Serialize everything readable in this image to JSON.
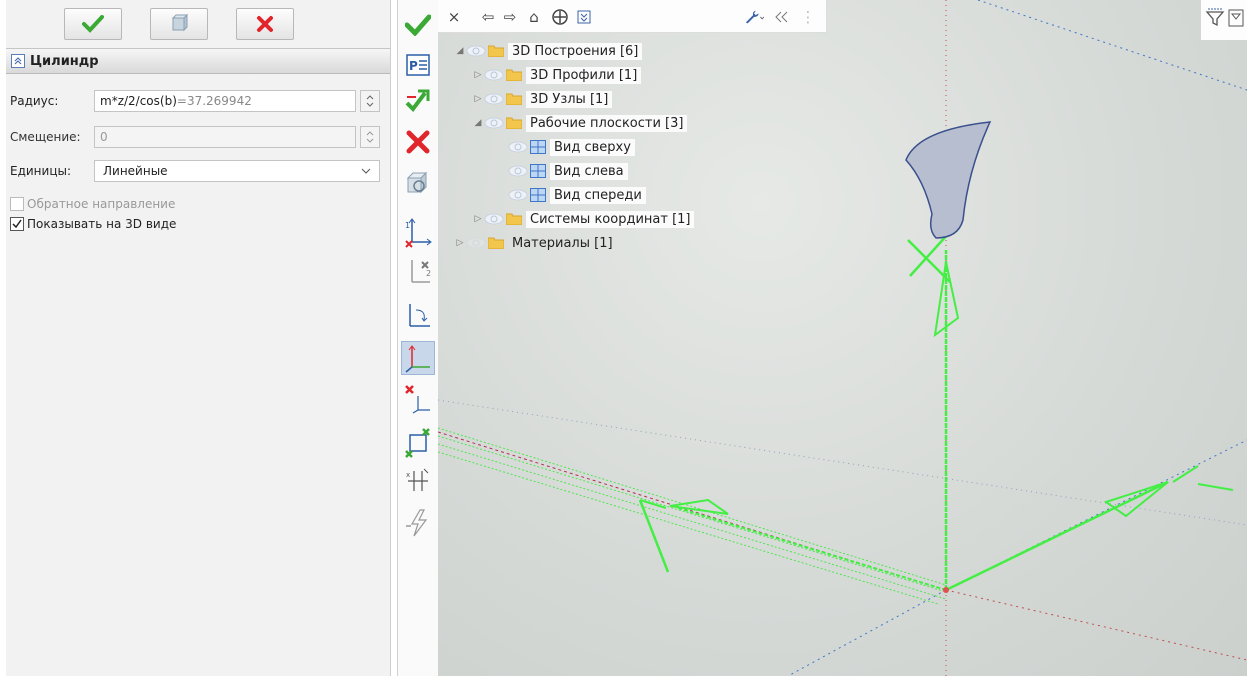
{
  "left_panel": {
    "buttons": {
      "ok_icon": "checkmark-icon",
      "preview_icon": "preview-icon",
      "cancel_icon": "cancel-icon"
    },
    "header_title": "Цилиндр",
    "fields": {
      "radius_label": "Радиус:",
      "radius_value": "m*z/2/cos(b)",
      "radius_computed": "=37.269942",
      "offset_label": "Смещение:",
      "offset_value": "0",
      "units_label": "Единицы:",
      "units_value": "Линейные"
    },
    "checks": {
      "reverse_label": "Обратное направление",
      "reverse_checked": false,
      "show3d_label": "Показывать на 3D виде",
      "show3d_checked": true
    }
  },
  "vertical_toolbar": {
    "items": [
      "ok-icon",
      "parameters-icon",
      "apply-icon",
      "cancel-icon",
      "preview-icon",
      "axis-x-icon",
      "axis-swap-icon",
      "rotate-axis-icon",
      "coord-system-icon",
      "remove-axis-icon",
      "remove-point-icon",
      "snap-icon",
      "disable-icon"
    ]
  },
  "viewport_toolbar": {
    "close": "×",
    "back": "⇦",
    "forward": "⇨",
    "home": "⌂"
  },
  "tree": [
    {
      "label": "3D Построения [6]",
      "level": 0,
      "expanded": true,
      "type": "folder"
    },
    {
      "label": "3D Профили [1]",
      "level": 1,
      "expanded": false,
      "type": "folder"
    },
    {
      "label": "3D Узлы [1]",
      "level": 1,
      "expanded": false,
      "type": "folder"
    },
    {
      "label": "Рабочие плоскости [3]",
      "level": 1,
      "expanded": true,
      "type": "folder"
    },
    {
      "label": "Вид сверху",
      "level": 2,
      "type": "plane"
    },
    {
      "label": "Вид слева",
      "level": 2,
      "type": "plane"
    },
    {
      "label": "Вид спереди",
      "level": 2,
      "type": "plane"
    },
    {
      "label": "Системы координат [1]",
      "level": 1,
      "expanded": false,
      "type": "folder"
    },
    {
      "label": "Материалы [1]",
      "level": 0,
      "expanded": false,
      "type": "folder"
    }
  ],
  "colors": {
    "accent_green": "#44ee44",
    "cancel_red": "#e0262b",
    "ok_green": "#3aa935",
    "profile_blue": "#3a4f8c"
  }
}
